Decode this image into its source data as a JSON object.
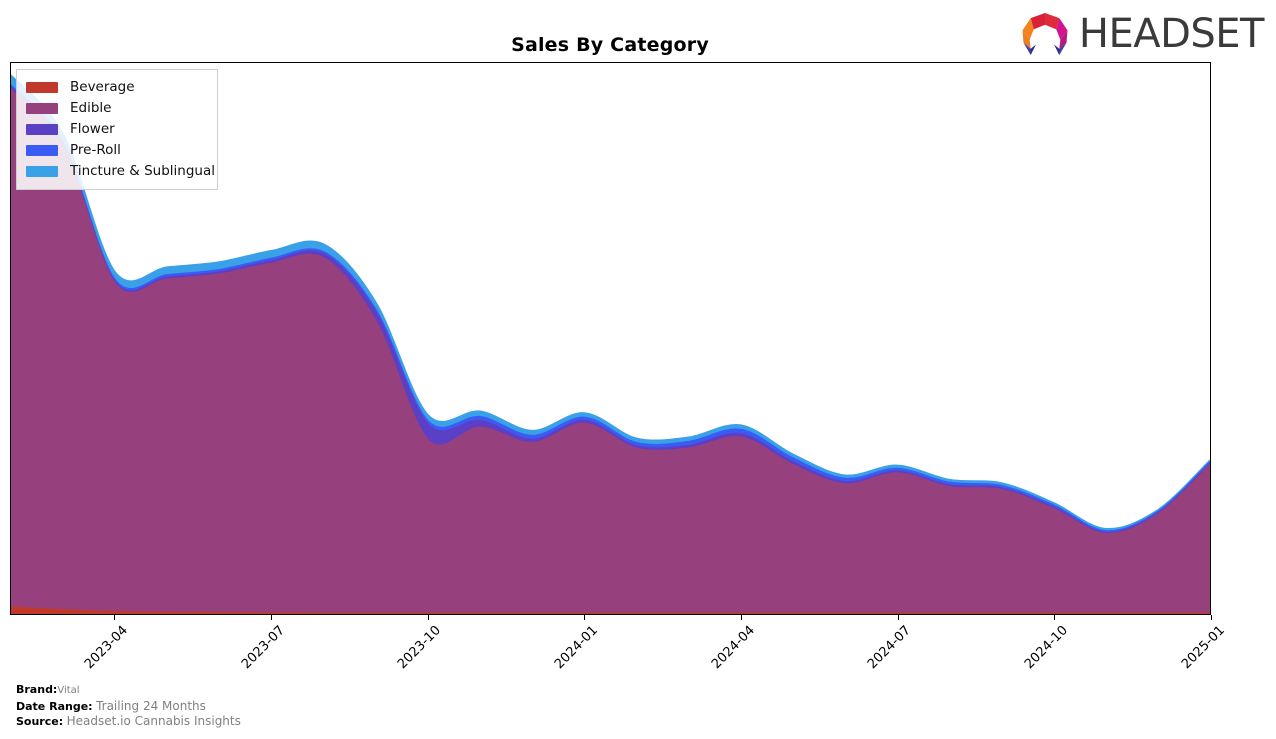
{
  "header": {
    "title": "Sales By Category",
    "logo_text": "HEADSET",
    "logo_icon": "headset-hexagon-logo"
  },
  "legend": {
    "position": "upper-left",
    "items": [
      {
        "label": "Beverage",
        "color": "#C0392B"
      },
      {
        "label": "Edible",
        "color": "#96407E"
      },
      {
        "label": "Flower",
        "color": "#5B3FC4"
      },
      {
        "label": "Pre-Roll",
        "color": "#3B5BF5"
      },
      {
        "label": "Tincture & Sublingual",
        "color": "#3AA0E8"
      }
    ]
  },
  "footer": {
    "brand_key": "Brand:",
    "brand_value": "Vital",
    "date_range_key": "Date Range:",
    "date_range_value": "Trailing 24 Months",
    "source_key": "Source:",
    "source_value": "Headset.io Cannabis Insights"
  },
  "chart_data": {
    "type": "area",
    "stacked": true,
    "title": "Sales By Category",
    "xlabel": "",
    "ylabel": "",
    "grid": false,
    "legend_position": "upper-left",
    "y_axis_visible": false,
    "x_tick_labels": [
      "2023-04",
      "2023-07",
      "2023-10",
      "2024-01",
      "2024-04",
      "2024-07",
      "2024-10",
      "2025-01"
    ],
    "x_tick_positions_pct": [
      10.9,
      29.6,
      48.3,
      65.8,
      84.5,
      96.7,
      109.0,
      100.0
    ],
    "x": [
      "2023-02",
      "2023-03",
      "2023-04",
      "2023-05",
      "2023-06",
      "2023-07",
      "2023-08",
      "2023-09",
      "2023-10",
      "2023-11",
      "2023-12",
      "2024-01",
      "2024-02",
      "2024-03",
      "2024-04",
      "2024-05",
      "2024-06",
      "2024-07",
      "2024-08",
      "2024-09",
      "2024-10",
      "2024-11",
      "2024-12",
      "2025-01"
    ],
    "ylim": [
      0,
      100
    ],
    "series": [
      {
        "name": "Beverage",
        "color": "#C0392B",
        "values": [
          1.2,
          0.7,
          0.35,
          0.2,
          0.12,
          0.08,
          0.05,
          0.04,
          0.03,
          0.03,
          0.02,
          0.02,
          0.02,
          0.02,
          0.02,
          0.02,
          0.02,
          0.02,
          0.02,
          0.02,
          0.02,
          0.02,
          0.02,
          0.02
        ]
      },
      {
        "name": "Edible",
        "color": "#96407E",
        "values": [
          94.0,
          84.0,
          59.5,
          60.5,
          61.5,
          63.5,
          64.5,
          53.0,
          31.5,
          33.8,
          31.0,
          34.5,
          30.0,
          30.0,
          32.0,
          27.0,
          23.5,
          25.5,
          23.0,
          22.5,
          19.0,
          14.5,
          18.0,
          27.0
        ]
      },
      {
        "name": "Flower",
        "color": "#5B3FC4",
        "values": [
          0.3,
          0.3,
          0.3,
          0.4,
          0.4,
          0.5,
          0.7,
          1.6,
          2.8,
          1.2,
          0.6,
          0.5,
          0.4,
          0.5,
          0.6,
          0.5,
          0.4,
          0.3,
          0.3,
          0.3,
          0.3,
          0.2,
          0.2,
          0.2
        ]
      },
      {
        "name": "Pre-Roll",
        "color": "#3B5BF5",
        "values": [
          0.4,
          0.4,
          0.4,
          0.4,
          0.4,
          0.4,
          0.4,
          0.5,
          0.6,
          0.7,
          0.7,
          0.6,
          0.6,
          0.7,
          0.8,
          0.7,
          0.6,
          0.5,
          0.5,
          0.4,
          0.4,
          0.3,
          0.3,
          0.3
        ]
      },
      {
        "name": "Tincture & Sublingual",
        "color": "#3AA0E8",
        "values": [
          1.8,
          1.6,
          1.4,
          1.4,
          1.4,
          1.4,
          1.4,
          1.3,
          1.1,
          1.0,
          0.9,
          0.8,
          0.8,
          0.8,
          0.8,
          0.7,
          0.6,
          0.6,
          0.5,
          0.5,
          0.4,
          0.4,
          0.3,
          0.3
        ]
      }
    ]
  }
}
